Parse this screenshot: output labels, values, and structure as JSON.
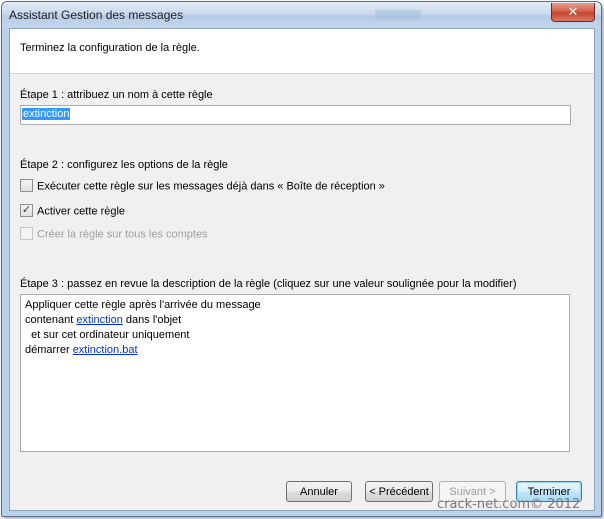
{
  "window": {
    "title": "Assistant Gestion des messages",
    "close_label": "✕"
  },
  "header": {
    "text": "Terminez la configuration de la règle."
  },
  "step1": {
    "label": "Étape 1 : attribuez un nom à cette règle",
    "name_value": "extinction"
  },
  "step2": {
    "label": "Étape 2 : configurez les options de la règle",
    "options": [
      {
        "label": "Exécuter cette règle sur les messages déjà dans « Boîte de réception »",
        "checked": false,
        "enabled": true
      },
      {
        "label": "Activer cette règle",
        "checked": true,
        "enabled": true
      },
      {
        "label": "Créer la règle sur tous les comptes",
        "checked": false,
        "enabled": false
      }
    ]
  },
  "step3": {
    "label": "Étape 3 : passez en revue la description de la règle (cliquez sur une valeur soulignée pour la modifier)",
    "line1": "Appliquer cette règle après l'arrivée du message",
    "line2_prefix": "contenant ",
    "line2_link": "extinction",
    "line2_suffix": " dans l'objet",
    "line3": "  et sur cet ordinateur uniquement",
    "line4_prefix": "démarrer ",
    "line4_link": "extinction.bat"
  },
  "buttons": {
    "cancel": "Annuler",
    "previous": "< Précédent",
    "next": "Suivant >",
    "finish": "Terminer"
  },
  "watermark": "crack-net.com© 2012",
  "colors": {
    "link": "#0033cc",
    "selection": "#3399ff",
    "close_button": "#c2442f"
  }
}
